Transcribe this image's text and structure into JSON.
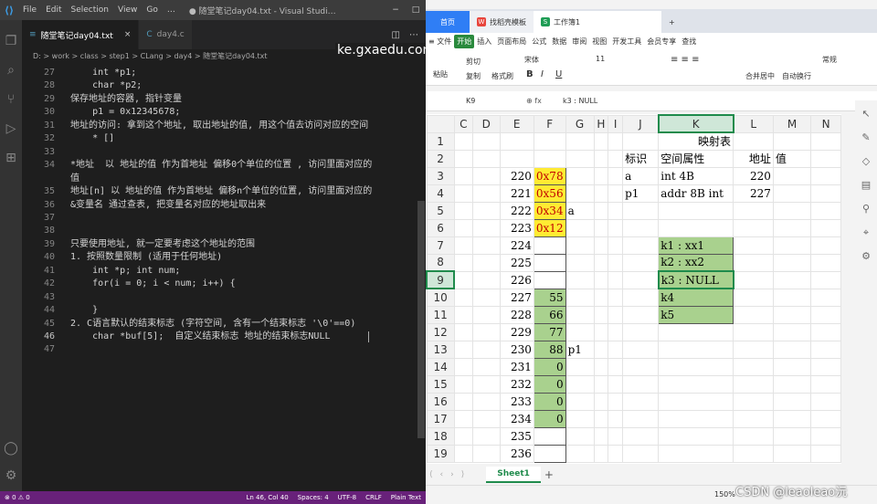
{
  "vscode": {
    "menu": [
      "File",
      "Edit",
      "Selection",
      "View",
      "Go",
      "…"
    ],
    "window_title": "● 随堂笔记day04.txt - Visual Studi…",
    "tabs": [
      {
        "label": "随堂笔记day04.txt",
        "icon": "txt-file-icon"
      },
      {
        "label": "day4.c",
        "icon": "c-file-icon"
      }
    ],
    "breadcrumb": "D: > work > class > step1 > CLang > day4 > 随堂笔记day04.txt",
    "overlay_url": "ke.gxaedu.com",
    "lines": [
      {
        "n": "27",
        "t": "    int *p1;"
      },
      {
        "n": "28",
        "t": "    char *p2;"
      },
      {
        "n": "29",
        "t": "保存地址的容器, 指针变量"
      },
      {
        "n": "30",
        "t": "    p1 = 0x12345678;"
      },
      {
        "n": "31",
        "t": "地址的访问: 拿到这个地址, 取出地址的值, 用这个值去访问对应的空间"
      },
      {
        "n": "32",
        "t": "    * []"
      },
      {
        "n": "33",
        "t": ""
      },
      {
        "n": "34",
        "t": "*地址  以 地址的值 作为首地址 偏移0个单位的位置 , 访问里面对应的"
      },
      {
        "n": "",
        "t": "值"
      },
      {
        "n": "35",
        "t": "地址[n] 以 地址的值 作为首地址 偏移n个单位的位置, 访问里面对应的"
      },
      {
        "n": "36",
        "t": "&变量名 通过查表, 把变量名对应的地址取出来"
      },
      {
        "n": "37",
        "t": ""
      },
      {
        "n": "38",
        "t": ""
      },
      {
        "n": "39",
        "t": "只要使用地址, 就一定要考虑这个地址的范围"
      },
      {
        "n": "40",
        "t": "1. 按照数量限制 (适用于任何地址)"
      },
      {
        "n": "41",
        "t": "    int *p; int num;"
      },
      {
        "n": "42",
        "t": "    for(i = 0; i < num; i++) {"
      },
      {
        "n": "43",
        "t": ""
      },
      {
        "n": "44",
        "t": "    }"
      },
      {
        "n": "45",
        "t": "2. C语言默认的结束标志 (字符空间, 含有一个结束标志 '\\0'==0)"
      },
      {
        "n": "46",
        "t": "    char *buf[5];  自定义结束标志 地址的结束标志NULL"
      },
      {
        "n": "47",
        "t": ""
      }
    ],
    "status": {
      "left": "⊗ 0 ⚠ 0",
      "pos": "Ln 46, Col 40",
      "spaces": "Spaces: 4",
      "enc": "UTF-8",
      "eol": "CRLF",
      "lang": "Plain Text"
    }
  },
  "spreadsheet": {
    "tabs": {
      "home": "首页",
      "template": "找稻壳模板",
      "book": "工作簿1",
      "add": "+"
    },
    "menu": [
      "≡ 文件",
      "开始",
      "插入",
      "页面布局",
      "公式",
      "数据",
      "审阅",
      "视图",
      "开发工具",
      "会员专享",
      "查找"
    ],
    "ribbon": {
      "paste": "粘贴",
      "cut": "剪切",
      "copy": "复制",
      "fmt": "格式刷",
      "font": "宋体",
      "size": "11",
      "merge": "合并居中",
      "wrap": "自动换行",
      "numfmt": "常规"
    },
    "cell_ref": "K9",
    "formula": "k3 : NULL",
    "columns": [
      "C",
      "D",
      "E",
      "F",
      "G",
      "H",
      "I",
      "J",
      "K",
      "L",
      "M",
      "N"
    ],
    "selected_col": "K",
    "selected_row": "9",
    "rows": [
      {
        "r": "1",
        "E": "",
        "F": "",
        "G": "",
        "J": "",
        "K": "映射表",
        "L": "",
        "M": ""
      },
      {
        "r": "2",
        "E": "",
        "F": "",
        "G": "",
        "J": "标识",
        "K": "空间属性",
        "L": "地址",
        "M": "值"
      },
      {
        "r": "3",
        "E": "220",
        "F": "0x78",
        "G": "",
        "J": "a",
        "K": "int 4B",
        "L": "220",
        "M": ""
      },
      {
        "r": "4",
        "E": "221",
        "F": "0x56",
        "G": "",
        "J": "p1",
        "K": "addr 8B int",
        "L": "227",
        "M": ""
      },
      {
        "r": "5",
        "E": "222",
        "F": "0x34",
        "G": "a",
        "J": "",
        "K": "",
        "L": "",
        "M": ""
      },
      {
        "r": "6",
        "E": "223",
        "F": "0x12",
        "G": "",
        "J": "",
        "K": "",
        "L": "",
        "M": ""
      },
      {
        "r": "7",
        "E": "224",
        "F": "",
        "G": "",
        "J": "",
        "K": "k1 : xx1",
        "L": "",
        "M": ""
      },
      {
        "r": "8",
        "E": "225",
        "F": "",
        "G": "",
        "J": "",
        "K": "k2 : xx2",
        "L": "",
        "M": ""
      },
      {
        "r": "9",
        "E": "226",
        "F": "",
        "G": "",
        "J": "",
        "K": "k3 : NULL",
        "L": "",
        "M": ""
      },
      {
        "r": "10",
        "E": "227",
        "F": "55",
        "G": "",
        "J": "",
        "K": "k4",
        "L": "",
        "M": ""
      },
      {
        "r": "11",
        "E": "228",
        "F": "66",
        "G": "",
        "J": "",
        "K": "k5",
        "L": "",
        "M": ""
      },
      {
        "r": "12",
        "E": "229",
        "F": "77",
        "G": "",
        "J": "",
        "K": "",
        "L": "",
        "M": ""
      },
      {
        "r": "13",
        "E": "230",
        "F": "88",
        "G": "p1",
        "J": "",
        "K": "",
        "L": "",
        "M": ""
      },
      {
        "r": "14",
        "E": "231",
        "F": "0",
        "G": "",
        "J": "",
        "K": "",
        "L": "",
        "M": ""
      },
      {
        "r": "15",
        "E": "232",
        "F": "0",
        "G": "",
        "J": "",
        "K": "",
        "L": "",
        "M": ""
      },
      {
        "r": "16",
        "E": "233",
        "F": "0",
        "G": "",
        "J": "",
        "K": "",
        "L": "",
        "M": ""
      },
      {
        "r": "17",
        "E": "234",
        "F": "0",
        "G": "",
        "J": "",
        "K": "",
        "L": "",
        "M": ""
      },
      {
        "r": "18",
        "E": "235",
        "F": "",
        "G": "",
        "J": "",
        "K": "",
        "L": "",
        "M": ""
      },
      {
        "r": "19",
        "E": "236",
        "F": "",
        "G": "",
        "J": "",
        "K": "",
        "L": "",
        "M": ""
      }
    ],
    "sheet_tab": "Sheet1",
    "zoom": "150%",
    "watermark": "CSDN @leaoleao沅"
  }
}
